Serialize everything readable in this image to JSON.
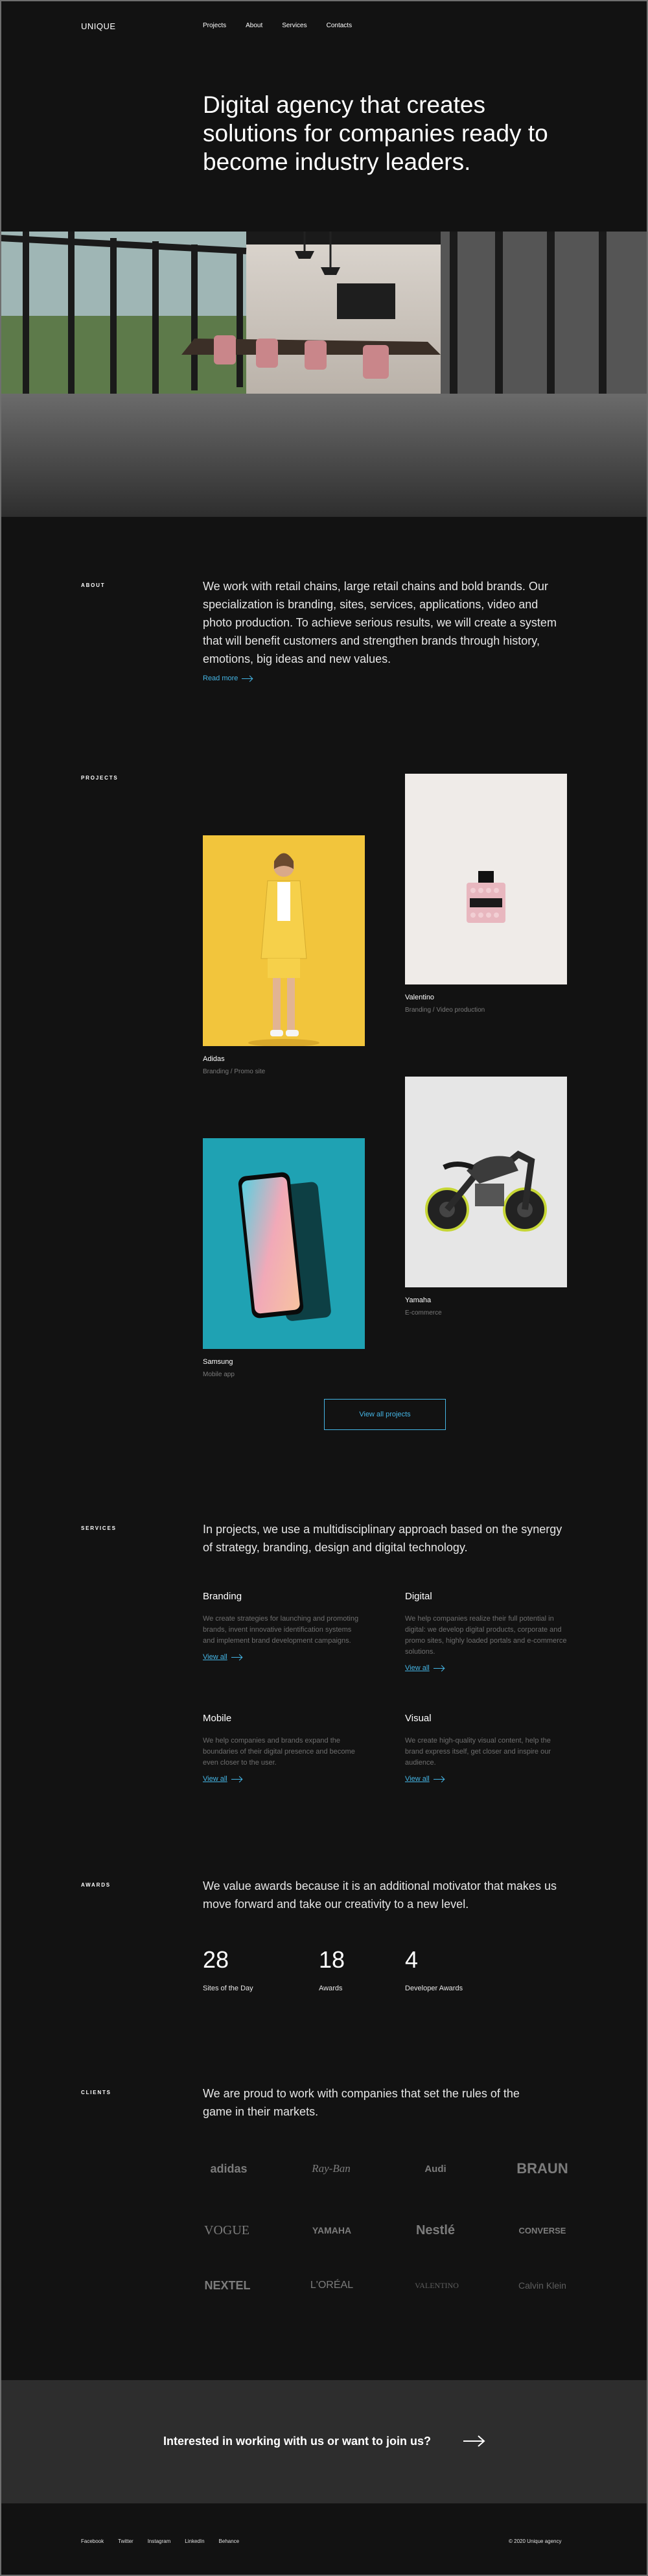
{
  "brand": "UNIQUE",
  "nav": [
    "Projects",
    "About",
    "Services",
    "Contacts"
  ],
  "hero": {
    "title": "Digital agency that creates solutions for companies ready to become industry leaders."
  },
  "about": {
    "label": "ABOUT",
    "text": "We work with retail chains, large retail chains and bold brands. Our specialization is branding, sites, services, applications, video and photo production. To achieve serious results, we will create a system that will benefit customers and strengthen brands through history, emotions, big ideas and new values.",
    "link": "Read more"
  },
  "projects": {
    "label": "PROJECTS",
    "items": [
      {
        "name": "Adidas",
        "category": "Branding / Promo site"
      },
      {
        "name": "Valentino",
        "category": "Branding / Video production"
      },
      {
        "name": "Samsung",
        "category": "Mobile app"
      },
      {
        "name": "Yamaha",
        "category": "E-commerce"
      }
    ],
    "view_all": "View all projects"
  },
  "services": {
    "label": "SERVICES",
    "intro": "In projects, we use a multidisciplinary approach based on the synergy of strategy, branding, design and digital technology.",
    "items": [
      {
        "title": "Branding",
        "desc": "We create strategies for launching and promoting brands, invent innovative identification systems and implement brand development campaigns.",
        "link": "View all"
      },
      {
        "title": "Digital",
        "desc": "We help companies realize their full potential in digital: we develop digital products, corporate and promo sites, highly loaded portals and e-commerce solutions.",
        "link": "View all"
      },
      {
        "title": "Mobile",
        "desc": "We help companies and brands expand the boundaries of their digital presence and become even closer to the user.",
        "link": "View all"
      },
      {
        "title": "Visual",
        "desc": "We create high-quality visual content, help the brand express itself, get closer and inspire our audience.",
        "link": "View all"
      }
    ]
  },
  "awards": {
    "label": "AWARDS",
    "intro": "We value awards because it is an additional motivator that makes us move forward and take our creativity to a new level.",
    "stats": [
      {
        "number": "28",
        "caption": "Sites of the Day"
      },
      {
        "number": "18",
        "caption": "Awards"
      },
      {
        "number": "4",
        "caption": "Developer Awards"
      }
    ]
  },
  "clients": {
    "label": "CLIENTS",
    "intro": "We are proud to work with companies that set the rules of the game in their markets.",
    "logos": [
      "adidas",
      "Ray-Ban",
      "Audi",
      "BRAUN",
      "VOGUE",
      "YAMAHA",
      "Nestlé",
      "CONVERSE",
      "NEXTEL",
      "L'ORÉAL",
      "VALENTINO",
      "Calvin Klein"
    ]
  },
  "cta": {
    "text": "Interested in working with us or want to join us?"
  },
  "footer": {
    "links": [
      "Facebook",
      "Twitter",
      "Instagram",
      "LinkedIn",
      "Behance"
    ],
    "copyright": "© 2020 Unique agency"
  },
  "colors": {
    "background": "#121212",
    "accent": "#45b6e6",
    "cta_bg": "#2d2d2d"
  }
}
